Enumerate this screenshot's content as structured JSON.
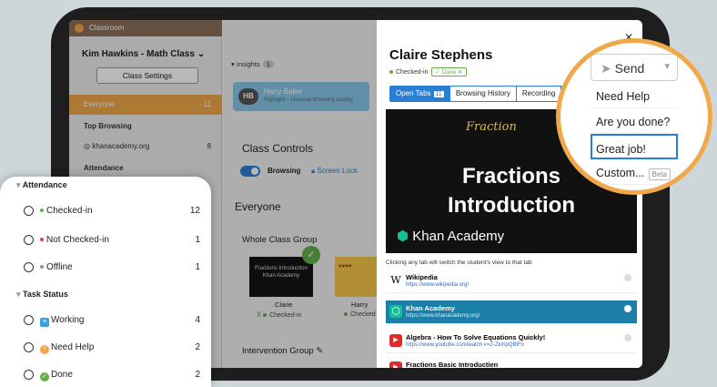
{
  "sidebar": {
    "app": "Classroom",
    "class_name": "Kim Hawkins - Math Class",
    "class_name_chevron": "chevron-down-icon",
    "settings_label": "Class Settings",
    "everyone_label": "Everyone",
    "everyone_count": "11",
    "top_browsing": "Top Browsing",
    "top_site": "khanacademy.org",
    "top_site_count": "8",
    "attendance_label": "Attendance"
  },
  "main": {
    "insights_label": "Insights",
    "insights_count": "1",
    "hb_initials": "HB",
    "hb_name": "Harry Baker",
    "hb_sub": "Highlight – Unusual browsing activity",
    "class_controls": "Class Controls",
    "browsing_label": "Browsing",
    "screen_lock_label": "Screen Lock",
    "everyone_heading": "Everyone",
    "whole_class_group": "Whole Class Group",
    "thumb_text": "Fractions Introduction",
    "thumb_brand": "Khan Academy",
    "student1": "Clarie",
    "student1_status": "Checked-in",
    "student2": "Harry",
    "student2_status": "Checked",
    "intervention_group": "Intervention Group"
  },
  "panel": {
    "student_name": "Claire Stephens",
    "checked_in": "Checked-in",
    "done_label": "Done",
    "tabs": {
      "open_tabs": "Open Tabs",
      "open_count": "11",
      "history": "Browsing History",
      "recording": "Recording"
    },
    "video": {
      "script": "Fraction",
      "title1": "Fractions",
      "title2": "Introduction",
      "brand": "Khan Academy"
    },
    "hint": "Clicking any tab will switch the student's view to that tab",
    "items": [
      {
        "title": "Wikipedia",
        "url": "https://www.wikipedia.org/",
        "icon": "W"
      },
      {
        "title": "Khan Academy",
        "url": "https://www.khanacademy.org/",
        "icon": "⬡"
      },
      {
        "title": "Algebra - How To Solve Equations Quickly!",
        "url": "https://www.youtube.com/watch v=Z-ZkmpQBlFo",
        "icon": "▶"
      },
      {
        "title": "Fractions Basic Introductien",
        "url": "",
        "icon": "▶"
      }
    ]
  },
  "send_menu": {
    "send_label": "Send",
    "options": [
      "Need Help",
      "Are you done?",
      "Great job!",
      "Custom..."
    ],
    "beta_label": "Beta",
    "selected": "Great job!"
  },
  "attendance_card": {
    "attendance_heading": "Attendance",
    "rows": [
      {
        "label": "Checked-in",
        "count": "12",
        "dot": "#63b04b"
      },
      {
        "label": "Not Checked-in",
        "count": "1",
        "dot": "#e0463c"
      },
      {
        "label": "Offline",
        "count": "1",
        "dot": "#999999"
      }
    ],
    "task_heading": "Task Status",
    "task_rows": [
      {
        "label": "Working",
        "count": "4",
        "color": "#3aa0e0"
      },
      {
        "label": "Need Help",
        "count": "2",
        "color": "#f0a84a"
      },
      {
        "label": "Done",
        "count": "2",
        "color": "#63b04b"
      }
    ]
  }
}
